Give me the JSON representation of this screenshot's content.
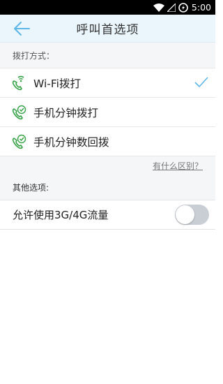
{
  "status_bar": {
    "time": "5:00"
  },
  "header": {
    "title": "呼叫首选项",
    "back_icon": "arrow-left-icon"
  },
  "dial_section": {
    "label": "拨打方式：",
    "options": [
      {
        "label": "Wi-Fi拨打",
        "icon": "wifi-phone-icon",
        "selected": true
      },
      {
        "label": "手机分钟拨打",
        "icon": "phone-check-icon",
        "selected": false
      },
      {
        "label": "手机分钟数回拨",
        "icon": "phone-check-icon",
        "selected": false
      }
    ],
    "diff_link": "有什么区别？"
  },
  "other_section": {
    "label": "其他选项:",
    "toggle_label": "允许使用3G/4G流量",
    "toggle_on": false
  },
  "colors": {
    "accent": "#5cb6e6",
    "green": "#3aa24a",
    "header_bg": "#eaf6fc"
  }
}
